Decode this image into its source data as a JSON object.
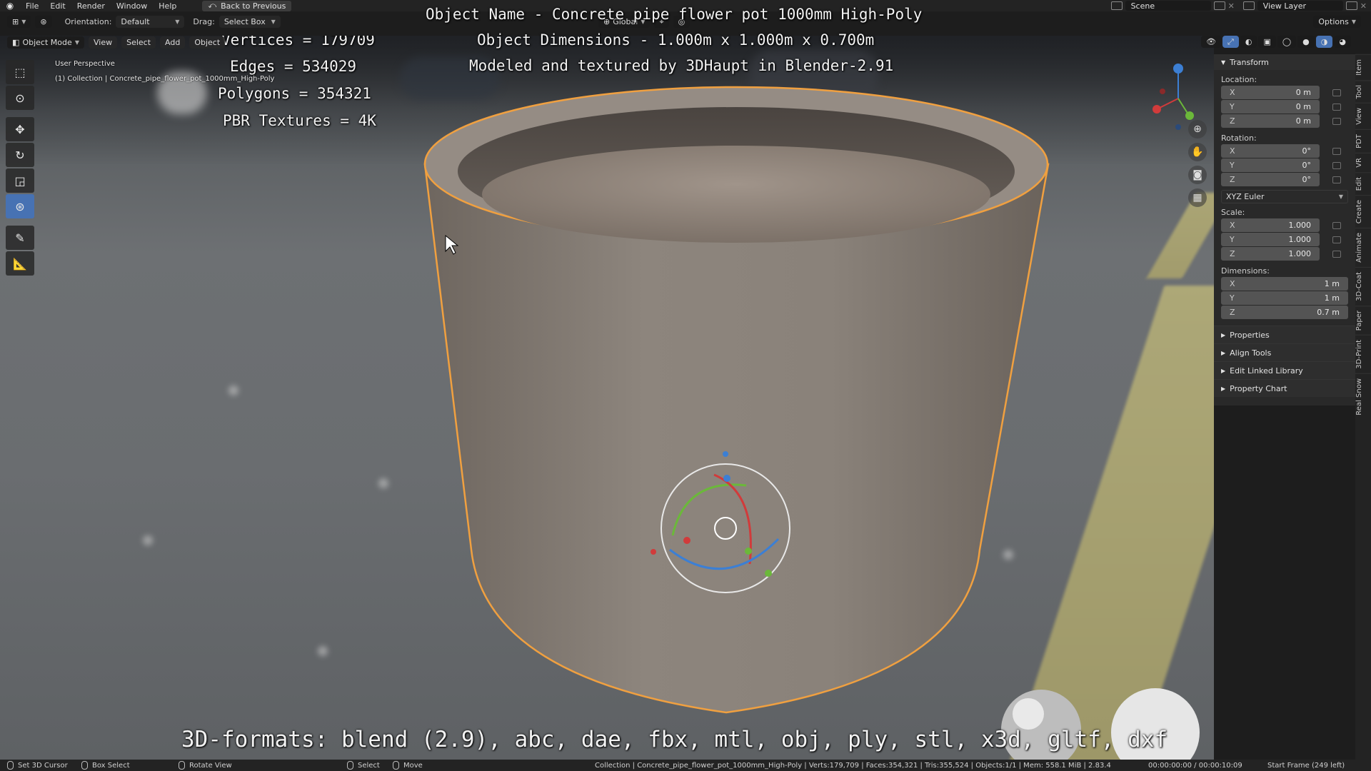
{
  "topbar": {
    "menu": [
      "File",
      "Edit",
      "Render",
      "Window",
      "Help"
    ],
    "back_button": "Back to Previous",
    "scene": "Scene",
    "view_layer": "View Layer"
  },
  "header": {
    "orientation_label": "Orientation:",
    "orientation_value": "Default",
    "drag_label": "Drag:",
    "drag_value": "Select Box",
    "transform_space": "Global",
    "mode": "Object Mode",
    "menus": [
      "View",
      "Select",
      "Add",
      "Object"
    ],
    "options": "Options"
  },
  "viewport": {
    "perspective": "User Perspective",
    "collection_info": "(1) Collection | Concrete_pipe_flower_pot_1000mm_High-Poly"
  },
  "overlay": {
    "vertices": "Vertices = 179709",
    "edges": "Edges = 534029",
    "polygons": "Polygons = 354321",
    "textures": "PBR Textures = 4K",
    "object_name": "Object Name - Concrete pipe flower pot 1000mm High-Poly",
    "dimensions": "Object Dimensions -  1.000m x 1.000m x 0.700m",
    "credit": "Modeled and textured by 3DHaupt in Blender-2.91",
    "formats": "3D-formats: blend (2.9), abc, dae, fbx, mtl, obj, ply, stl, x3d, gltf, dxf"
  },
  "npanel": {
    "title": "Transform",
    "location_label": "Location:",
    "location": [
      {
        "axis": "X",
        "value": "0 m"
      },
      {
        "axis": "Y",
        "value": "0 m"
      },
      {
        "axis": "Z",
        "value": "0 m"
      }
    ],
    "rotation_label": "Rotation:",
    "rotation": [
      {
        "axis": "X",
        "value": "0°"
      },
      {
        "axis": "Y",
        "value": "0°"
      },
      {
        "axis": "Z",
        "value": "0°"
      }
    ],
    "rotation_mode": "XYZ Euler",
    "scale_label": "Scale:",
    "scale": [
      {
        "axis": "X",
        "value": "1.000"
      },
      {
        "axis": "Y",
        "value": "1.000"
      },
      {
        "axis": "Z",
        "value": "1.000"
      }
    ],
    "dimensions_label": "Dimensions:",
    "dimensions": [
      {
        "axis": "X",
        "value": "1 m"
      },
      {
        "axis": "Y",
        "value": "1 m"
      },
      {
        "axis": "Z",
        "value": "0.7 m"
      }
    ],
    "subpanels": [
      "Properties",
      "Align Tools",
      "Edit Linked Library",
      "Property Chart"
    ]
  },
  "sidetabs": [
    "Item",
    "Tool",
    "View",
    "PDT",
    "VR",
    "Edit",
    "Create",
    "Animate",
    "3D-Coat",
    "Paper",
    "3D-Print",
    "Real Snow"
  ],
  "statusbar": {
    "set_cursor": "Set 3D Cursor",
    "box_select": "Box Select",
    "rotate_view": "Rotate View",
    "select": "Select",
    "move": "Move",
    "stats": "Collection | Concrete_pipe_flower_pot_1000mm_High-Poly | Verts:179,709 | Faces:354,321 | Tris:355,524 | Objects:1/1 | Mem: 558.1 MiB | 2.83.4",
    "time": "00:00:00:00 / 00:00:10:09",
    "frame": "Start Frame (249 left)"
  },
  "colors": {
    "accent": "#4772b3",
    "selection_outline": "#f0a040",
    "concrete": "#8a8078"
  }
}
